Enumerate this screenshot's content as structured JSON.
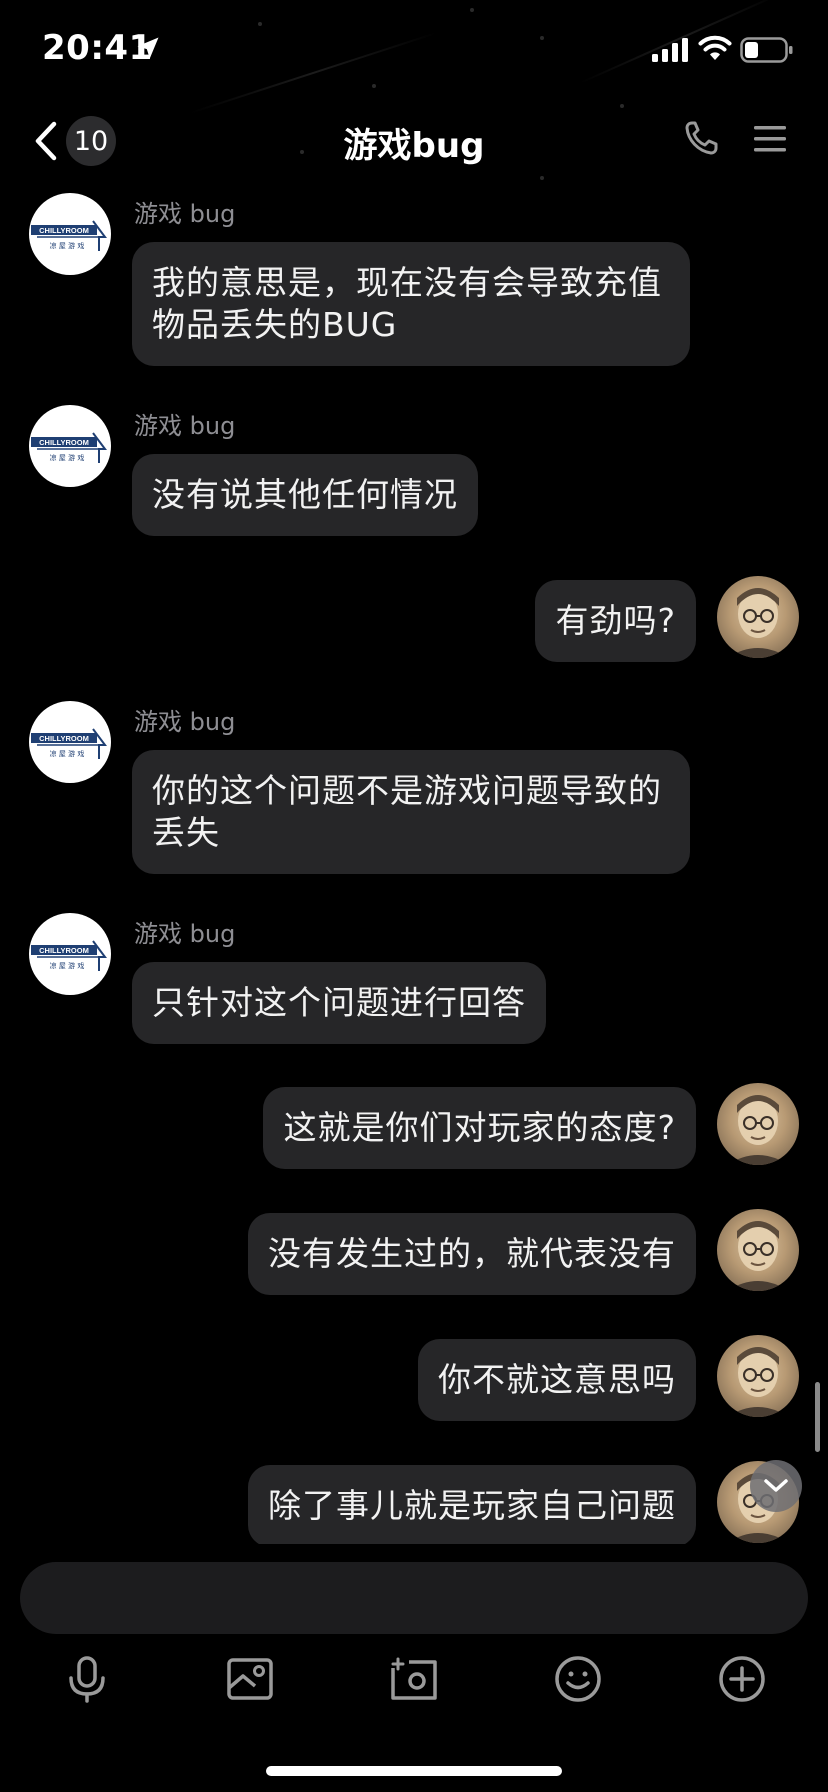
{
  "status_bar": {
    "time": "20:41"
  },
  "nav": {
    "unread_count": "10",
    "title": "游戏bug"
  },
  "messages": [
    {
      "side": "left",
      "sender": "游戏 bug",
      "text_lines": [
        "我的意思是，现在没有会导致充值",
        "物品丢失的BUG"
      ]
    },
    {
      "side": "left",
      "sender": "游戏 bug",
      "text_lines": [
        "没有说其他任何情况"
      ]
    },
    {
      "side": "right",
      "text_lines": [
        "有劲吗?"
      ]
    },
    {
      "side": "left",
      "sender": "游戏 bug",
      "text_lines": [
        "你的这个问题不是游戏问题导致的",
        "丢失"
      ]
    },
    {
      "side": "left",
      "sender": "游戏 bug",
      "text_lines": [
        "只针对这个问题进行回答"
      ]
    },
    {
      "side": "right",
      "text_lines": [
        "这就是你们对玩家的态度?"
      ]
    },
    {
      "side": "right",
      "text_lines": [
        "没有发生过的，就代表没有"
      ]
    },
    {
      "side": "right",
      "text_lines": [
        "你不就这意思吗"
      ]
    },
    {
      "side": "right",
      "text_lines": [
        "除了事儿就是玩家自己问题"
      ]
    }
  ],
  "bot_avatar": {
    "brand_text": "CHILLYROOM",
    "sub_text": "凉 屋 游 戏"
  },
  "toolbar": {
    "icons": [
      "microphone-icon",
      "image-icon",
      "camera-icon",
      "emoji-icon",
      "plus-icon"
    ]
  },
  "colors": {
    "background": "#000000",
    "bubble": "#262628",
    "text": "#f2f2f2",
    "secondary_text": "#8e8e93"
  }
}
